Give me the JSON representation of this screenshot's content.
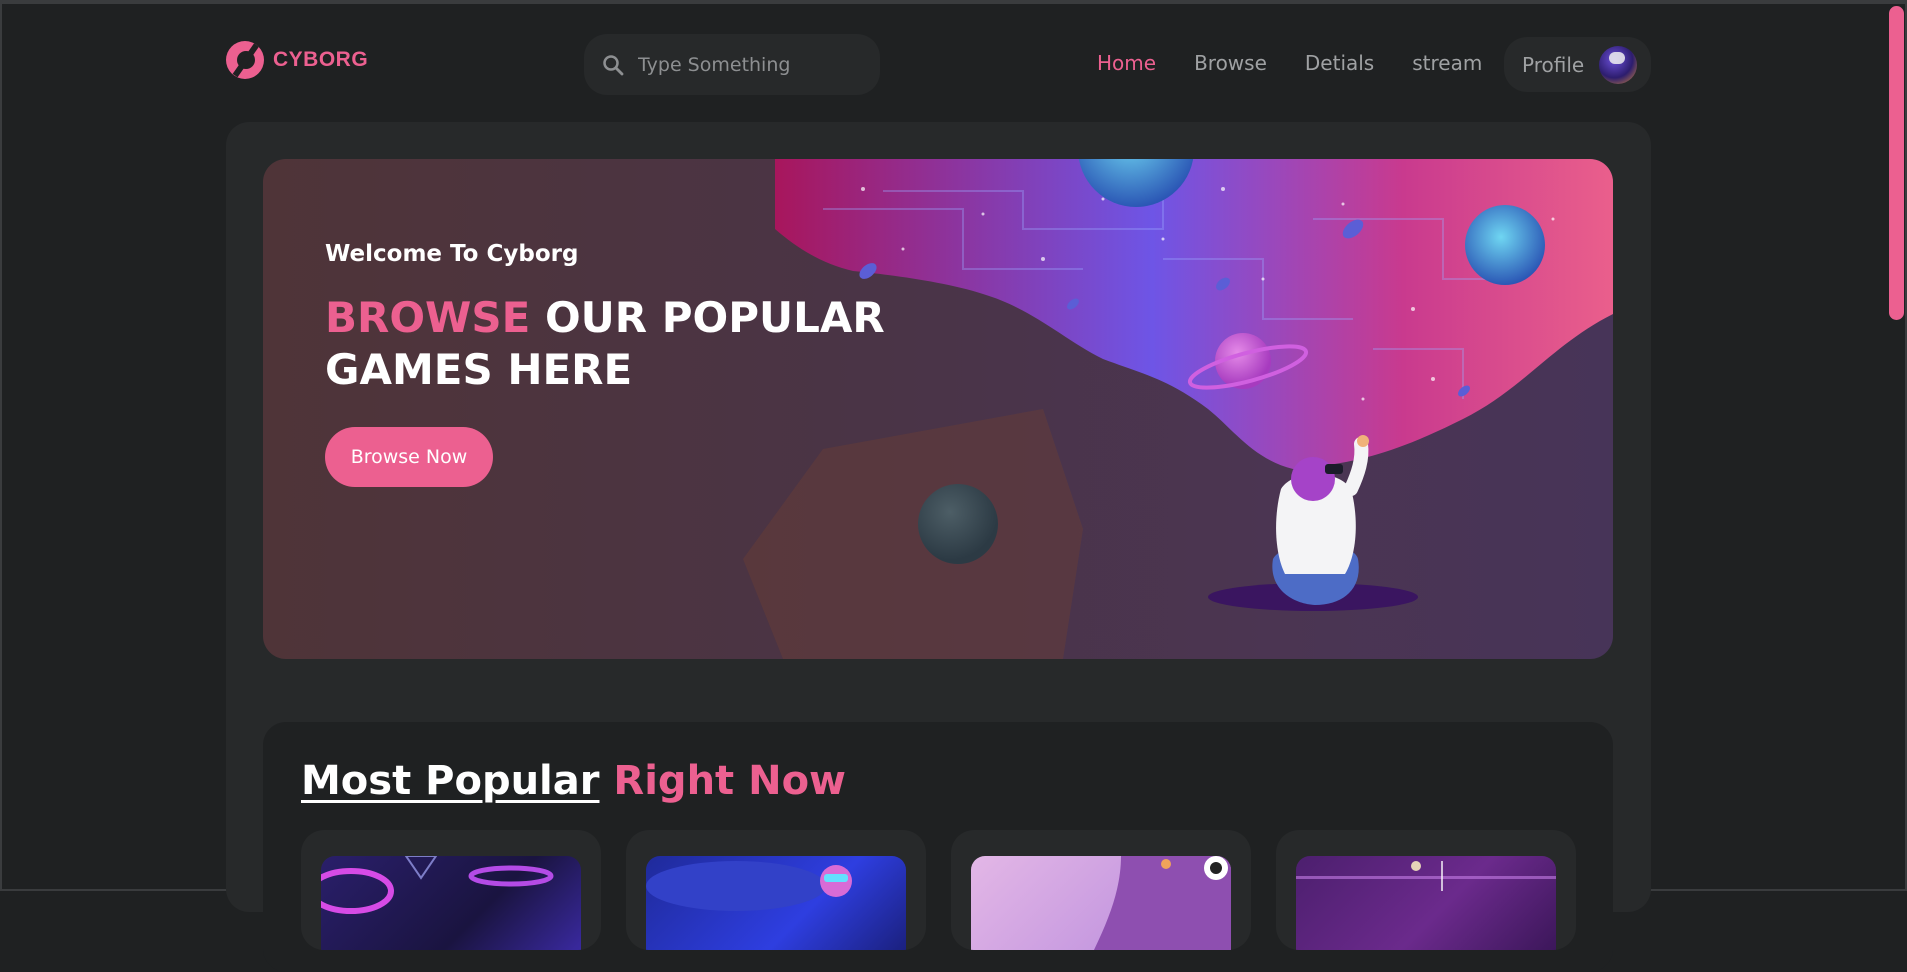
{
  "colors": {
    "accent": "#ec6090",
    "page_background": "#1f2122",
    "panel_background": "#27292a",
    "text_primary": "#ffffff",
    "text_muted": "#9fa1a3"
  },
  "header": {
    "logo_text": "CYBORG",
    "search": {
      "placeholder": "Type Something",
      "icon": "search-icon"
    },
    "nav": {
      "items": [
        {
          "label": "Home",
          "active": true
        },
        {
          "label": "Browse",
          "active": false
        },
        {
          "label": "Detials",
          "active": false
        },
        {
          "label": "stream",
          "active": false
        }
      ]
    },
    "profile": {
      "label": "Profile"
    }
  },
  "banner": {
    "welcome": "Welcome To Cyborg",
    "headline_accent": "BROWSE",
    "headline_rest": "OUR POPULAR GAMES HERE",
    "button_label": "Browse Now"
  },
  "popular": {
    "title_underlined": "Most Popular",
    "title_accent": "Right Now",
    "cards": [
      {
        "thumb_color": "#2a1f6b"
      },
      {
        "thumb_color": "#1f2a9a"
      },
      {
        "thumb_color": "#e3b7e6"
      },
      {
        "thumb_color": "#4c1f6e"
      }
    ]
  }
}
